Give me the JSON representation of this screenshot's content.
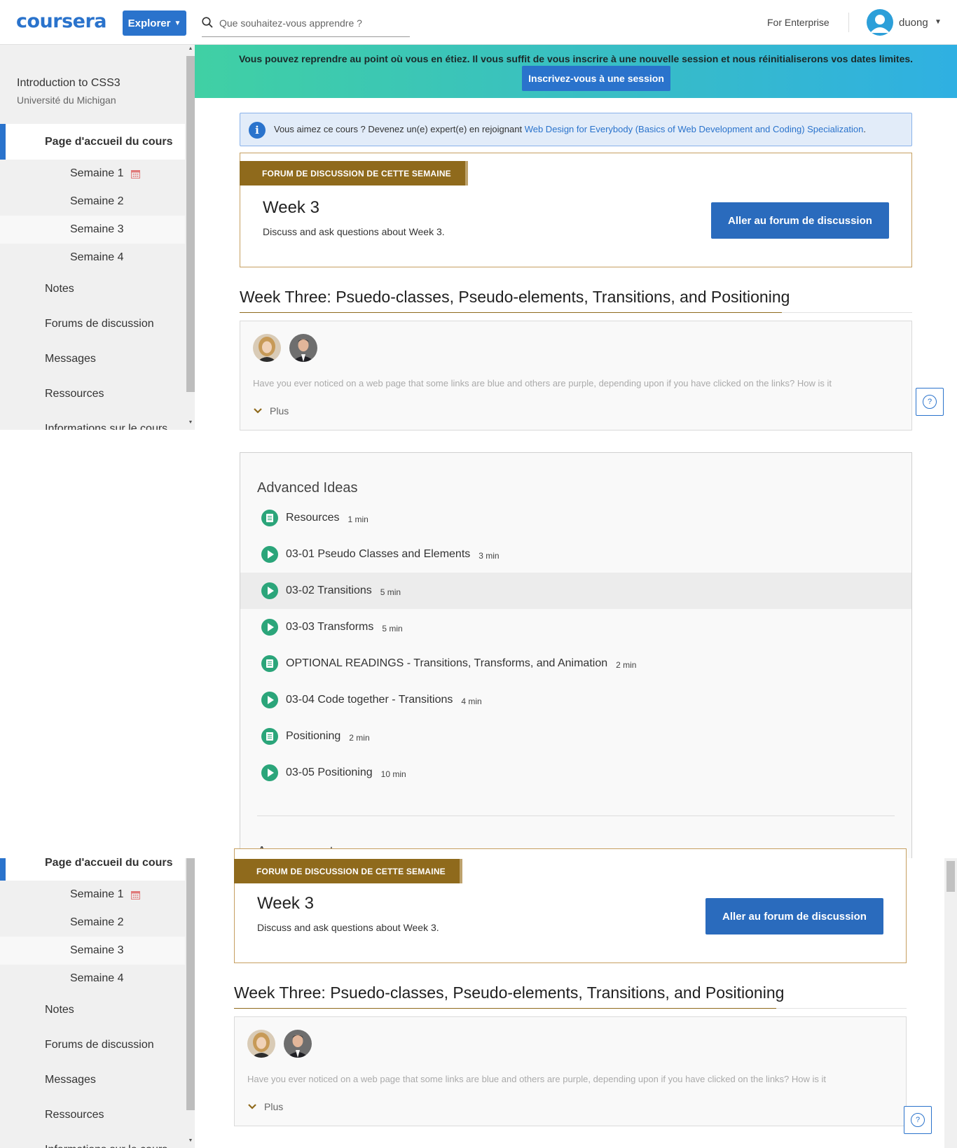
{
  "header": {
    "logo": "coursera",
    "explore_label": "Explorer",
    "search_placeholder": "Que souhaitez-vous apprendre ?",
    "enterprise_link": "For Enterprise",
    "username": "duong"
  },
  "sidebar": {
    "course_title": "Introduction to CSS3",
    "course_university": "Université du Michigan",
    "home_label": "Page d'accueil du cours",
    "weeks": [
      "Semaine 1",
      "Semaine 2",
      "Semaine 3",
      "Semaine 4"
    ],
    "nav": [
      "Notes",
      "Forums de discussion",
      "Messages",
      "Ressources",
      "Informations sur le cours"
    ]
  },
  "banner": {
    "text": "Vous pouvez reprendre au point où vous en étiez. Il vous suffit de vous inscrire à une nouvelle session et nous réinitialiserons vos dates limites.",
    "button": "Inscrivez-vous à une session"
  },
  "info": {
    "text": "Vous aimez ce cours ? Devenez un(e) expert(e) en rejoignant ",
    "link": "Web Design for Everybody (Basics of Web Development and Coding) Specialization",
    "suffix": "."
  },
  "forum": {
    "tag": "FORUM DE DISCUSSION DE CETTE SEMAINE",
    "week": "Week 3",
    "description": "Discuss and ask questions about Week 3.",
    "button": "Aller au forum de discussion"
  },
  "week": {
    "title": "Week Three: Psuedo-classes, Pseudo-elements, Transitions, and Positioning",
    "description": "Have you ever noticed on a web page that some links are blue and others are purple, depending upon if you have clicked on the links? How is it",
    "more": "Plus"
  },
  "module": {
    "heading": "Advanced Ideas",
    "lessons": [
      {
        "title": "Resources",
        "duration": "1 min",
        "type": "reading"
      },
      {
        "title": "03-01 Pseudo Classes and Elements",
        "duration": "3 min",
        "type": "video"
      },
      {
        "title": "03-02 Transitions",
        "duration": "5 min",
        "type": "video"
      },
      {
        "title": "03-03 Transforms",
        "duration": "5 min",
        "type": "video"
      },
      {
        "title": "OPTIONAL READINGS - Transitions, Transforms, and Animation",
        "duration": "2 min",
        "type": "reading"
      },
      {
        "title": "03-04 Code together - Transitions",
        "duration": "4 min",
        "type": "video"
      },
      {
        "title": "Positioning",
        "duration": "2 min",
        "type": "reading"
      },
      {
        "title": "03-05 Positioning",
        "duration": "10 min",
        "type": "video"
      }
    ],
    "next_heading": "Assessment"
  },
  "help_label": "?",
  "colors": {
    "brand_blue": "#2a73cc",
    "forum_tag": "#8f6a1c",
    "lesson_icon": "#2ba57a"
  }
}
